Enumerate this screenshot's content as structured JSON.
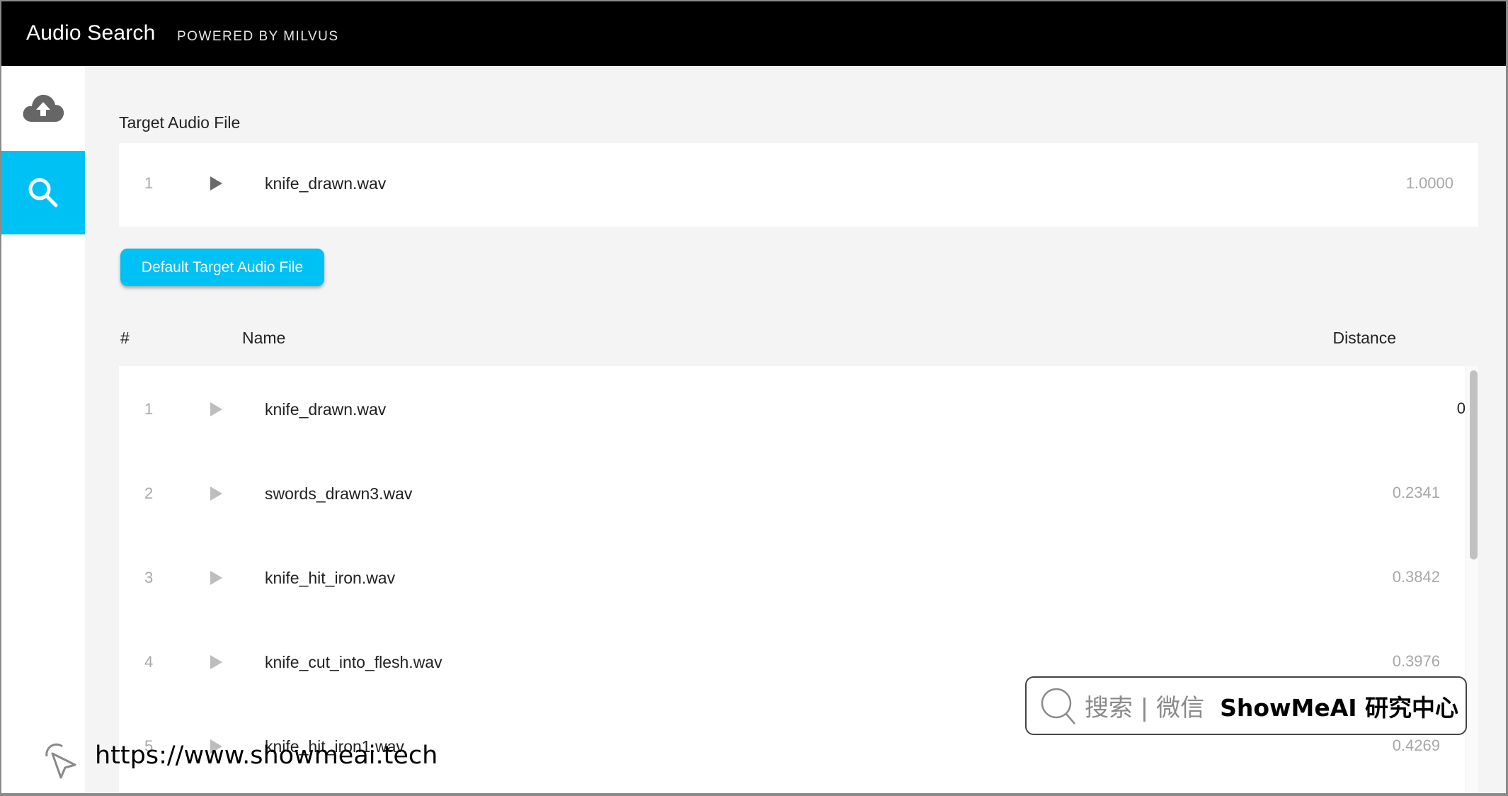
{
  "header": {
    "title": "Audio Search",
    "subtitle": "POWERED BY MILVUS"
  },
  "sidebar": {
    "items": [
      {
        "name": "upload",
        "icon": "cloud-upload-icon",
        "active": false
      },
      {
        "name": "search",
        "icon": "search-icon",
        "active": true
      }
    ],
    "accent_color": "#00c1f3"
  },
  "target": {
    "label": "Target Audio File",
    "file": {
      "index": "1",
      "name": "knife_drawn.wav",
      "score": "1.0000"
    }
  },
  "default_button": {
    "label": "Default Target Audio File"
  },
  "results_table": {
    "headers": {
      "index": "#",
      "name": "Name",
      "distance": "Distance"
    },
    "rows": [
      {
        "index": "1",
        "name": "knife_drawn.wav",
        "distance": "0"
      },
      {
        "index": "2",
        "name": "swords_drawn3.wav",
        "distance": "0.2341"
      },
      {
        "index": "3",
        "name": "knife_hit_iron.wav",
        "distance": "0.3842"
      },
      {
        "index": "4",
        "name": "knife_cut_into_flesh.wav",
        "distance": "0.3976"
      },
      {
        "index": "5",
        "name": "knife_hit_iron1.wav",
        "distance": "0.4269"
      }
    ]
  },
  "watermark": {
    "search_text": "搜索 | 微信",
    "brand_text": "ShowMeAI 研究中心",
    "url": "https://www.showmeai.tech"
  }
}
